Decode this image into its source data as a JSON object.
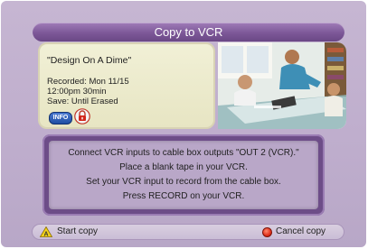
{
  "window": {
    "title": "Copy to VCR"
  },
  "program": {
    "title": "\"Design On A Dime\"",
    "recorded": "Recorded: Mon 11/15",
    "time_duration": "12:00pm  30min",
    "save": "Save: Until Erased",
    "info_label": "INFO",
    "lock_icon": "lock-icon"
  },
  "instructions": {
    "lines": [
      "Connect VCR inputs to cable box outputs \"OUT 2 (VCR).\"",
      "Place a blank tape in your VCR.",
      "Set your VCR input to record from the cable box.",
      "Press RECORD on your VCR."
    ]
  },
  "footer": {
    "start_label": "Start copy",
    "cancel_label": "Cancel copy",
    "start_icon": "yellow-triangle-icon",
    "cancel_icon": "red-circle-icon"
  },
  "colors": {
    "background": "#c2b2cf",
    "title_bar": "#7d5898",
    "card": "#efedd3",
    "instruction_frame": "#6d4d88"
  }
}
